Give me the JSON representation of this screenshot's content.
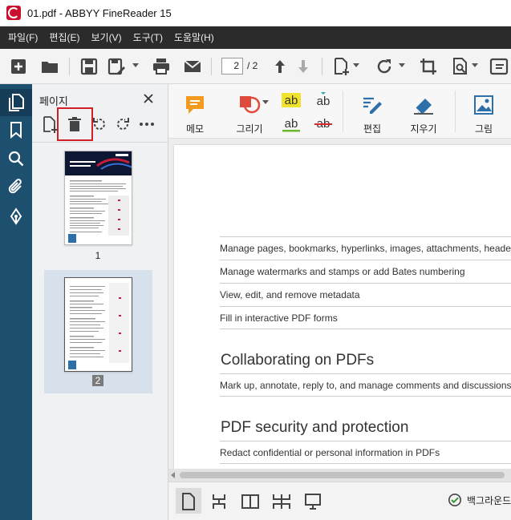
{
  "window": {
    "title": "01.pdf - ABBYY FineReader 15"
  },
  "menu": [
    "파일(F)",
    "편집(E)",
    "보기(V)",
    "도구(T)",
    "도움말(H)"
  ],
  "toolbar": {
    "current_page": "2",
    "total_pages": "/ 2"
  },
  "panel": {
    "title": "페이지",
    "thumbnails": [
      {
        "label": "1",
        "selected": false
      },
      {
        "label": "2",
        "selected": true
      }
    ]
  },
  "ribbon": {
    "memo": "메모",
    "draw": "그리기",
    "edit": "편집",
    "erase": "지우기",
    "image": "그림",
    "text_tool_glyph": "ab"
  },
  "document": {
    "rows_top": [
      "Manage pages, bookmarks, hyperlinks, images, attachments, headers a",
      "Manage watermarks and stamps or add Bates numbering",
      "View, edit, and remove metadata",
      "Fill in interactive PDF forms"
    ],
    "heading_collab": "Collaborating on PDFs",
    "row_collab": "Mark up, annotate, reply to, and manage comments and discussions in P",
    "heading_security": "PDF security and protection",
    "row_security": "Redact confidential or personal information in PDFs"
  },
  "statusbar": {
    "background_label": "백그라운드"
  },
  "colors": {
    "menubar": "#2b2b2b",
    "rail": "#1d4f6e",
    "highlight": "#d32026",
    "memo_icon": "#f29b1f",
    "draw_icon": "#e04a3a",
    "text_highlight": "#f1e22b",
    "accent_blue": "#2d6fa9"
  }
}
